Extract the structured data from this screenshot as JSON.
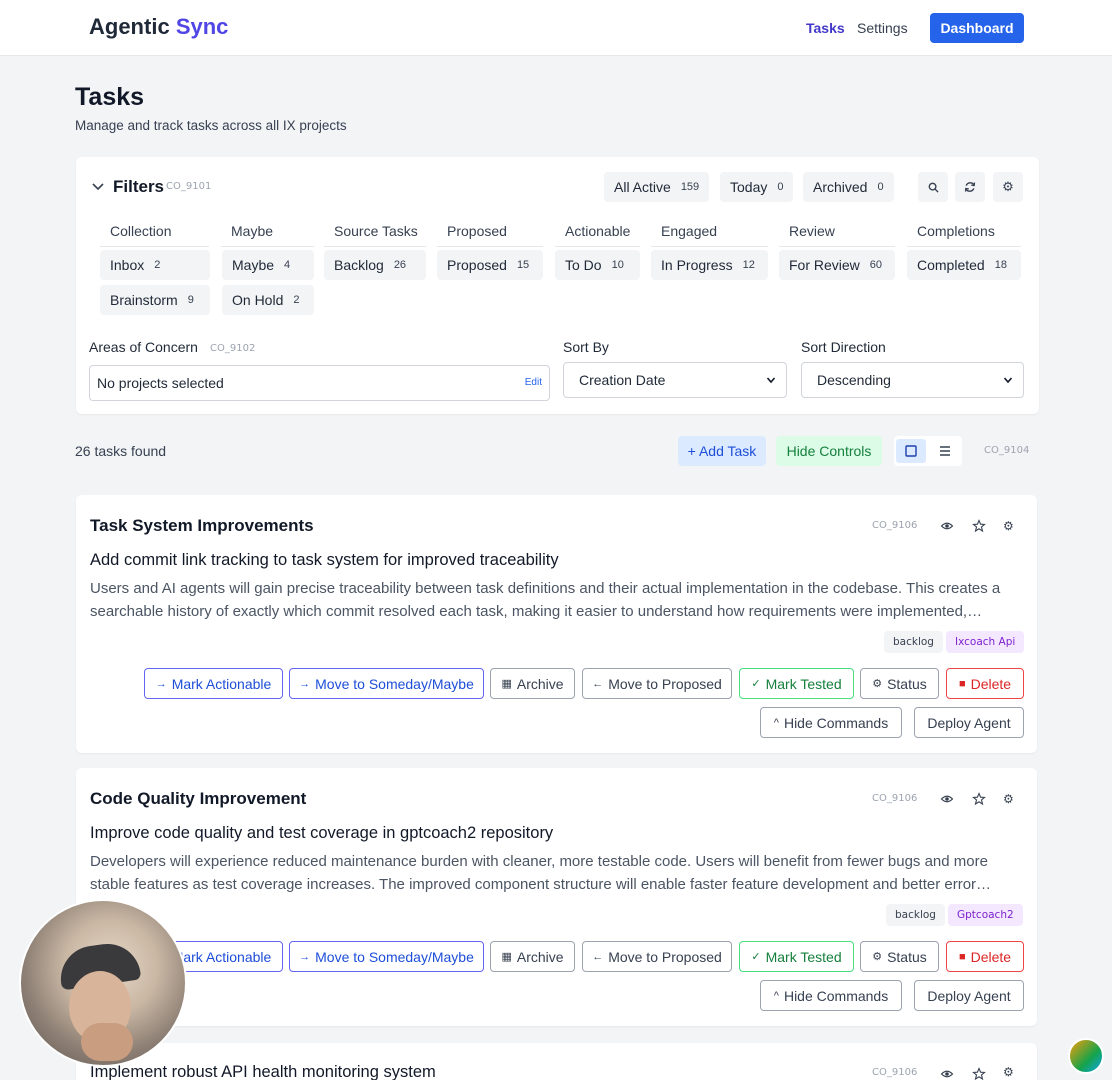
{
  "app": {
    "brand_main": "Agentic",
    "brand_accent": "Sync",
    "nav_tasks": "Tasks",
    "nav_settings": "Settings",
    "dashboard": "Dashboard"
  },
  "page": {
    "title": "Tasks",
    "subtitle": "Manage and track tasks across all IX projects"
  },
  "filters": {
    "title": "Filters",
    "code": "CO_9101",
    "quick": [
      {
        "label": "All Active",
        "count": "159"
      },
      {
        "label": "Today",
        "count": "0"
      },
      {
        "label": "Archived",
        "count": "0"
      }
    ],
    "columns": [
      {
        "head": "Collection",
        "items": [
          {
            "label": "Inbox",
            "count": "2"
          },
          {
            "label": "Brainstorm",
            "count": "9"
          }
        ]
      },
      {
        "head": "Maybe",
        "items": [
          {
            "label": "Maybe",
            "count": "4"
          },
          {
            "label": "On Hold",
            "count": "2"
          }
        ]
      },
      {
        "head": "Source Tasks",
        "items": [
          {
            "label": "Backlog",
            "count": "26"
          }
        ]
      },
      {
        "head": "Proposed",
        "items": [
          {
            "label": "Proposed",
            "count": "15"
          }
        ]
      },
      {
        "head": "Actionable",
        "items": [
          {
            "label": "To Do",
            "count": "10"
          }
        ]
      },
      {
        "head": "Engaged",
        "items": [
          {
            "label": "In Progress",
            "count": "12"
          }
        ]
      },
      {
        "head": "Review",
        "items": [
          {
            "label": "For Review",
            "count": "60"
          }
        ]
      },
      {
        "head": "Completions",
        "items": [
          {
            "label": "Completed",
            "count": "18"
          }
        ]
      }
    ],
    "areas_label": "Areas of Concern",
    "areas_code": "CO_9102",
    "areas_value": "No projects selected",
    "areas_edit": "Edit",
    "sort_label": "Sort By",
    "sort_value": "Creation Date",
    "dir_label": "Sort Direction",
    "dir_value": "Descending"
  },
  "toolbar": {
    "found": "26 tasks found",
    "add": "+ Add Task",
    "hide": "Hide Controls",
    "code": "CO_9104"
  },
  "tasks": [
    {
      "project": "Task System Improvements",
      "code": "CO_9106",
      "title": "Add commit link tracking to task system for improved traceability",
      "desc": "Users and AI agents will gain precise traceability between task definitions and their actual implementation in the codebase. This creates a searchable history of exactly which commit resolved each task, making it easier to understand how requirements were implemented, reviewed, and verified over time.",
      "tags": [
        "backlog",
        "Ixcoach Api"
      ]
    },
    {
      "project": "Code Quality Improvement",
      "code": "CO_9106",
      "title": "Improve code quality and test coverage in gptcoach2 repository",
      "desc": "Developers will experience reduced maintenance burden with cleaner, more testable code. Users will benefit from fewer bugs and more stable features as test coverage increases. The improved component structure will enable faster feature development and better error handling across the app.",
      "tags": [
        "backlog",
        "Gptcoach2"
      ]
    },
    {
      "project": "",
      "code": "CO_9106",
      "title": "Implement robust API health monitoring system",
      "desc": "",
      "tags": []
    }
  ],
  "actions": {
    "actionable": "Mark Actionable",
    "someday": "Move to Someday/Maybe",
    "archive": "Archive",
    "proposed": "Move to Proposed",
    "tested": "Mark Tested",
    "status": "Status",
    "delete": "Delete",
    "hide_cmds": "Hide Commands",
    "deploy": "Deploy Agent"
  },
  "colors": {
    "accent": "#4f46e5",
    "primary": "#2563eb",
    "success": "#15803d",
    "danger": "#dc2626"
  }
}
